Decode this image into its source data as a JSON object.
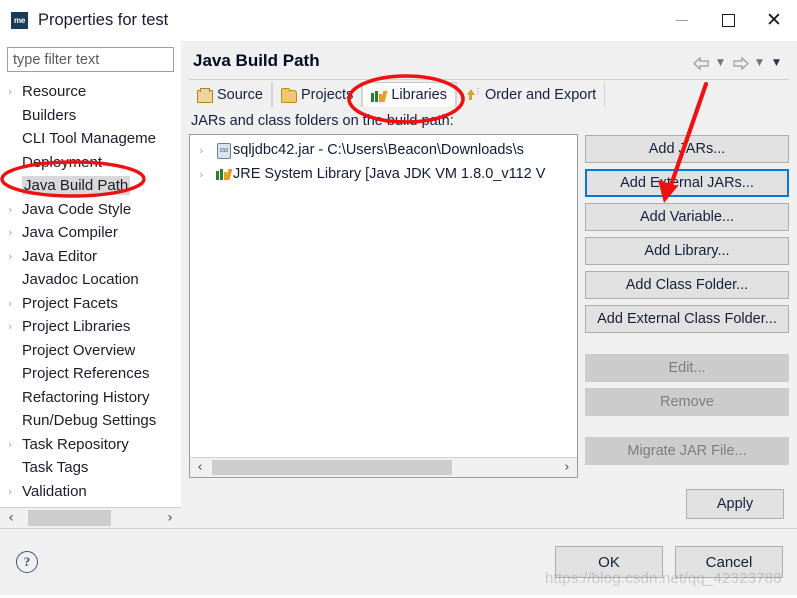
{
  "window": {
    "title": "Properties for test",
    "app_icon_label": "me",
    "controls": {
      "minimize": "minimize-button",
      "maximize": "maximize-button",
      "close": "close-button"
    }
  },
  "filter": {
    "placeholder": "type filter text",
    "value": ""
  },
  "sidebar": {
    "items": [
      {
        "label": "Resource",
        "expandable": true,
        "selected": false
      },
      {
        "label": "Builders",
        "expandable": false,
        "selected": false
      },
      {
        "label": "CLI Tool Manageme",
        "expandable": false,
        "selected": false
      },
      {
        "label": "Deployment",
        "expandable": false,
        "selected": false
      },
      {
        "label": "Java Build Path",
        "expandable": false,
        "selected": true
      },
      {
        "label": "Java Code Style",
        "expandable": true,
        "selected": false
      },
      {
        "label": "Java Compiler",
        "expandable": true,
        "selected": false
      },
      {
        "label": "Java Editor",
        "expandable": true,
        "selected": false
      },
      {
        "label": "Javadoc Location",
        "expandable": false,
        "selected": false
      },
      {
        "label": "Project Facets",
        "expandable": true,
        "selected": false
      },
      {
        "label": "Project Libraries",
        "expandable": true,
        "selected": false
      },
      {
        "label": "Project Overview",
        "expandable": false,
        "selected": false
      },
      {
        "label": "Project References",
        "expandable": false,
        "selected": false
      },
      {
        "label": "Refactoring History",
        "expandable": false,
        "selected": false
      },
      {
        "label": "Run/Debug Settings",
        "expandable": false,
        "selected": false
      },
      {
        "label": "Task Repository",
        "expandable": true,
        "selected": false
      },
      {
        "label": "Task Tags",
        "expandable": false,
        "selected": false
      },
      {
        "label": "Validation",
        "expandable": true,
        "selected": false
      }
    ],
    "scroll_left_arrow": "‹",
    "scroll_right_arrow": "›"
  },
  "page": {
    "title": "Java Build Path",
    "nav": {
      "back_arrow": "back-arrow",
      "back_caret": "▼",
      "forward_arrow": "forward-arrow",
      "forward_caret": "▼",
      "menu_caret": "▼"
    },
    "tabs": [
      {
        "label": "Source",
        "icon": "source-folder-icon",
        "active": false
      },
      {
        "label": "Projects",
        "icon": "projects-folder-icon",
        "active": false
      },
      {
        "label": "Libraries",
        "icon": "libraries-books-icon",
        "active": true
      },
      {
        "label": "Order and Export",
        "icon": "order-export-icon",
        "active": false
      }
    ],
    "list_caption": "JARs and class folders on the build path:",
    "entries": [
      {
        "icon": "jar-file-icon",
        "label": "sqljdbc42.jar - C:\\Users\\Beacon\\Downloads\\s"
      },
      {
        "icon": "library-books-icon",
        "label": "JRE System Library [Java JDK VM 1.8.0_v112 V"
      }
    ],
    "scroll_left_arrow": "‹",
    "scroll_right_arrow": "›",
    "buttons": [
      {
        "label": "Add JARs...",
        "state": "normal"
      },
      {
        "label": "Add External JARs...",
        "state": "focused"
      },
      {
        "label": "Add Variable...",
        "state": "normal"
      },
      {
        "label": "Add Library...",
        "state": "normal"
      },
      {
        "label": "Add Class Folder...",
        "state": "normal"
      },
      {
        "label": "Add External Class Folder...",
        "state": "normal"
      },
      {
        "label": "Edit...",
        "state": "disabled"
      },
      {
        "label": "Remove",
        "state": "disabled"
      },
      {
        "label": "Migrate JAR File...",
        "state": "disabled"
      }
    ],
    "apply_label": "Apply"
  },
  "footer": {
    "help_glyph": "?",
    "ok_label": "OK",
    "cancel_label": "Cancel"
  },
  "annotations": {
    "watermark": "https://blog.csdn.net/qq_42323788",
    "highlight_color": "#ee1111",
    "ellipse_sidebar_target": "Java Build Path",
    "ellipse_tab_target": "Libraries",
    "arrow_target": "Add External JARs..."
  }
}
